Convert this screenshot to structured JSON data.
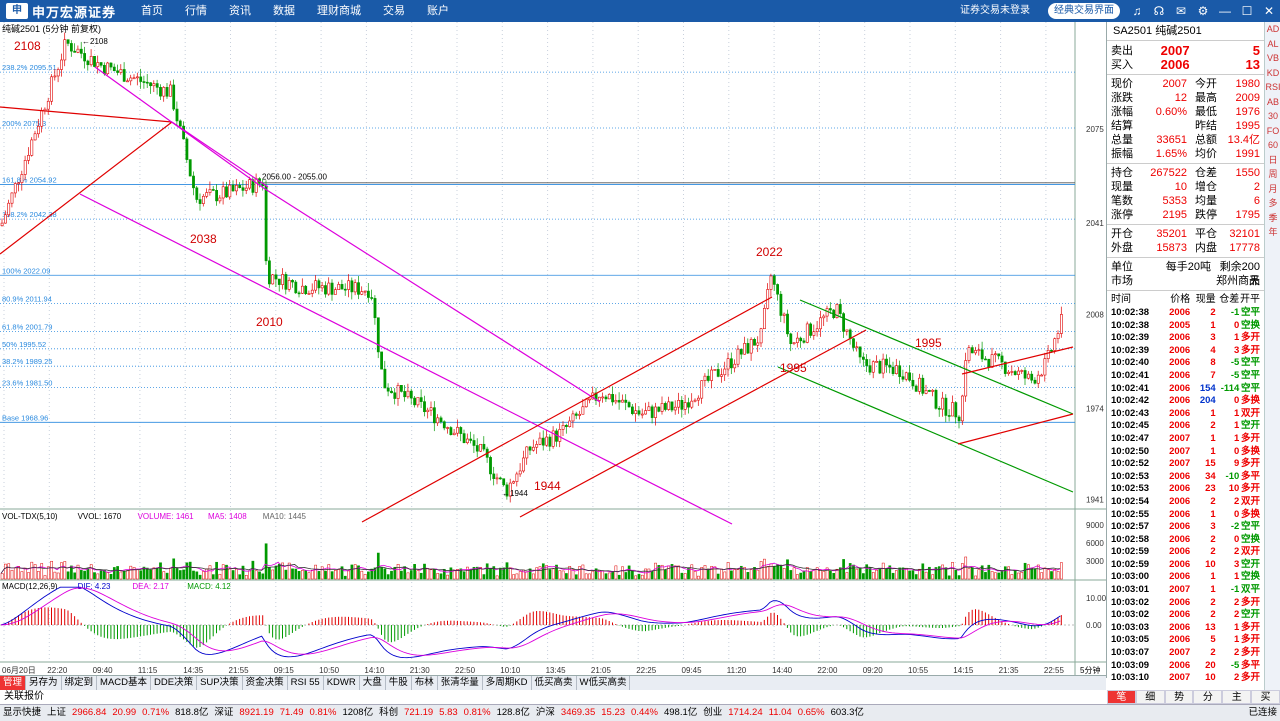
{
  "topbar": {
    "logo_mark": "申",
    "logo_text": "申万宏源证券",
    "menu": [
      "首页",
      "行情",
      "资讯",
      "数据",
      "理财商城",
      "交易",
      "账户"
    ],
    "login_status": "证券交易未登录",
    "classic_button": "经典交易界面"
  },
  "chart": {
    "title": "纯碱2501 (5分钟 前复权)",
    "high_marker": "2108",
    "low_marker": "1944",
    "callout_labels": [
      "2108",
      "2038",
      "2010",
      "1944",
      "2022",
      "1995",
      "1995"
    ],
    "fib_levels": [
      {
        "label": "238.2% 2095.51",
        "price": 2095.51
      },
      {
        "label": "200% 2075.3",
        "price": 2075.3
      },
      {
        "label": "161.8% 2054.92",
        "price": 2054.92
      },
      {
        "label": "138.2% 2042.38",
        "price": 2042.38
      },
      {
        "label": "100% 2022.09",
        "price": 2022.09
      },
      {
        "label": "80.9% 2011.94",
        "price": 2011.94
      },
      {
        "label": "61.8% 2001.79",
        "price": 2001.79
      },
      {
        "label": "50% 1995.52",
        "price": 1995.52
      },
      {
        "label": "38.2% 1989.25",
        "price": 1989.25
      },
      {
        "label": "23.6% 1981.50",
        "price": 1981.5
      },
      {
        "label": "Base 1968.96",
        "price": 1968.96
      }
    ],
    "range_label": "2056.00 - 2055.00",
    "price_axis": [
      "2075",
      "2041",
      "2008",
      "1974",
      "1941"
    ],
    "vol_indicator": {
      "name": "VOL-TDX(5,10)",
      "vvol": "VVOL: 1670",
      "volume": "VOLUME: 1461",
      "ma5": "MA5: 1408",
      "ma10": "MA10: 1445"
    },
    "vol_axis": [
      "9000",
      "6000",
      "3000"
    ],
    "macd_indicator": {
      "name": "MACD(12,26,9)",
      "dif": "DIF: 4.23",
      "dea": "DEA: 2.17",
      "macd": "MACD: 4.12"
    },
    "macd_axis": [
      "10.00",
      "0.00"
    ],
    "time_axis": [
      "06月20日",
      "22:20",
      "09:40",
      "11:15",
      "14:35",
      "21:55",
      "09:15",
      "10:50",
      "14:10",
      "21:30",
      "22:50",
      "10:10",
      "13:45",
      "21:05",
      "22:25",
      "09:45",
      "11:20",
      "14:40",
      "22:00",
      "09:20",
      "10:55",
      "14:15",
      "21:35",
      "22:55"
    ],
    "period": "5分钟",
    "colors": {
      "up": "#e00000",
      "down": "#009900",
      "magenta": "#dd00dd",
      "fib": "#2a8adf",
      "ma5": "#d400d4",
      "dif": "#0000cc"
    }
  },
  "bottom_tabs": [
    "管理",
    "另存为",
    "绑定到",
    "MACD基本",
    "DDE决策",
    "SUP决策",
    "资金决策",
    "RSI 55",
    "KDWR",
    "大盘",
    "牛股",
    "布林",
    "张清华量",
    "多周期KD",
    "低买高卖",
    "W低买高卖"
  ],
  "quote": {
    "symbol": "SA2501",
    "name": "纯碱2501",
    "ask": {
      "label": "卖出",
      "price": "2007",
      "vol": "5"
    },
    "bid": {
      "label": "买入",
      "price": "2006",
      "vol": "13"
    },
    "rows1": [
      [
        "现价",
        "2007",
        "今开",
        "1980"
      ],
      [
        "涨跌",
        "12",
        "最高",
        "2009"
      ],
      [
        "涨幅",
        "0.60%",
        "最低",
        "1976"
      ],
      [
        "结算",
        "",
        "昨结",
        "1995"
      ],
      [
        "总量",
        "33651",
        "总额",
        "13.4亿"
      ],
      [
        "振幅",
        "1.65%",
        "均价",
        "1991"
      ]
    ],
    "rows2": [
      [
        "持仓",
        "267522",
        "仓差",
        "1550"
      ],
      [
        "现量",
        "10",
        "增仓",
        "2"
      ],
      [
        "笔数",
        "5353",
        "均量",
        "6"
      ],
      [
        "涨停",
        "2195",
        "跌停",
        "1795"
      ]
    ],
    "rows3": [
      [
        "开仓",
        "35201",
        "平仓",
        "32101"
      ],
      [
        "外盘",
        "15873",
        "内盘",
        "17778"
      ]
    ],
    "unit": {
      "label": "单位",
      "value": "每手20吨",
      "remain": "剩余200天"
    },
    "market": {
      "label": "市场",
      "value": "郑州商品"
    },
    "trade_headers": [
      "时间",
      "价格",
      "现量",
      "仓差",
      "开平"
    ],
    "trades": [
      [
        "10:02:38",
        "2006",
        "2",
        "-1",
        "空平"
      ],
      [
        "10:02:38",
        "2005",
        "1",
        "0",
        "空换"
      ],
      [
        "10:02:39",
        "2006",
        "3",
        "1",
        "多开"
      ],
      [
        "10:02:39",
        "2006",
        "4",
        "3",
        "多开"
      ],
      [
        "10:02:40",
        "2006",
        "8",
        "-5",
        "空平"
      ],
      [
        "10:02:41",
        "2006",
        "7",
        "-5",
        "空平"
      ],
      [
        "10:02:41",
        "2006",
        "154",
        "-114",
        "空平"
      ],
      [
        "10:02:42",
        "2006",
        "204",
        "0",
        "多换"
      ],
      [
        "10:02:43",
        "2006",
        "1",
        "1",
        "双开"
      ],
      [
        "10:02:45",
        "2006",
        "2",
        "1",
        "空开"
      ],
      [
        "10:02:47",
        "2007",
        "1",
        "1",
        "多开"
      ],
      [
        "10:02:50",
        "2007",
        "1",
        "0",
        "多换"
      ],
      [
        "10:02:52",
        "2007",
        "15",
        "9",
        "多开"
      ],
      [
        "10:02:53",
        "2006",
        "34",
        "-10",
        "多平"
      ],
      [
        "10:02:53",
        "2006",
        "23",
        "10",
        "多开"
      ],
      [
        "10:02:54",
        "2006",
        "2",
        "2",
        "双开"
      ],
      [
        "10:02:55",
        "2006",
        "1",
        "0",
        "多换"
      ],
      [
        "10:02:57",
        "2006",
        "3",
        "-2",
        "空平"
      ],
      [
        "10:02:58",
        "2006",
        "2",
        "0",
        "空换"
      ],
      [
        "10:02:59",
        "2006",
        "2",
        "2",
        "双开"
      ],
      [
        "10:02:59",
        "2006",
        "10",
        "3",
        "空开"
      ],
      [
        "10:03:00",
        "2006",
        "1",
        "1",
        "空换"
      ],
      [
        "10:03:01",
        "2007",
        "1",
        "-1",
        "双平"
      ],
      [
        "10:03:02",
        "2006",
        "2",
        "2",
        "多开"
      ],
      [
        "10:03:02",
        "2006",
        "2",
        "2",
        "空开"
      ],
      [
        "10:03:03",
        "2006",
        "13",
        "1",
        "多开"
      ],
      [
        "10:03:05",
        "2006",
        "5",
        "1",
        "多开"
      ],
      [
        "10:03:07",
        "2007",
        "2",
        "2",
        "多开"
      ],
      [
        "10:03:09",
        "2006",
        "20",
        "-5",
        "多平"
      ],
      [
        "10:03:10",
        "2007",
        "10",
        "2",
        "多开"
      ]
    ],
    "tabs": [
      "笔",
      "细",
      "势",
      "分",
      "主",
      "买"
    ]
  },
  "side_toolbar": [
    "AD",
    "AL",
    "VB",
    "KD",
    "RSI",
    "AB",
    "30",
    "FO",
    "60",
    "日",
    "周",
    "月",
    "多",
    "季",
    "年"
  ],
  "quote_label": "关联报价",
  "statusbar": {
    "app": "显示快捷",
    "items": [
      [
        "上证",
        "2966.84",
        "20.99",
        "0.71%",
        "818.8亿"
      ],
      [
        "深证",
        "8921.19",
        "71.49",
        "0.81%",
        "1208亿"
      ],
      [
        "科创",
        "721.19",
        "5.83",
        "0.81%",
        "128.8亿"
      ],
      [
        "沪深",
        "3469.35",
        "15.23",
        "0.44%",
        "498.1亿"
      ],
      [
        "创业",
        "1714.24",
        "11.04",
        "0.65%",
        "603.3亿"
      ]
    ],
    "connection": "已连接"
  }
}
